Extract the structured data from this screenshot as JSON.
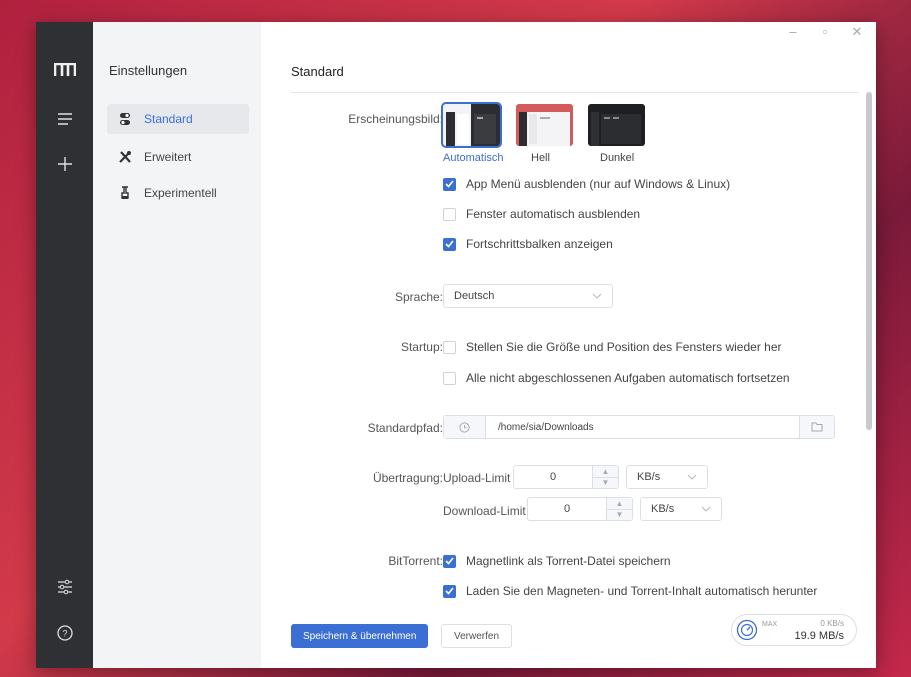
{
  "rail": {
    "logo": "m-logo",
    "icons": [
      "menu-icon",
      "plus-icon",
      "sliders-icon",
      "help-icon"
    ]
  },
  "sidebar": {
    "title": "Einstellungen",
    "items": [
      {
        "label": "Standard",
        "icon": "toggle-icon",
        "active": true
      },
      {
        "label": "Erweitert",
        "icon": "tools-icon",
        "active": false
      },
      {
        "label": "Experimentell",
        "icon": "flask-icon",
        "active": false
      }
    ]
  },
  "window_controls": [
    "minimize-icon",
    "maximize-icon",
    "close-icon"
  ],
  "main": {
    "title": "Standard",
    "appearance": {
      "label": "Erscheinungsbild:",
      "options": [
        "Automatisch",
        "Hell",
        "Dunkel"
      ],
      "selected": "Automatisch",
      "checks": [
        {
          "label": "App Menü ausblenden (nur auf Windows & Linux)",
          "checked": true
        },
        {
          "label": "Fenster automatisch ausblenden",
          "checked": false
        },
        {
          "label": "Fortschrittsbalken anzeigen",
          "checked": true
        }
      ]
    },
    "language": {
      "label": "Sprache:",
      "value": "Deutsch"
    },
    "startup": {
      "label": "Startup:",
      "checks": [
        {
          "label": "Stellen Sie die Größe und Position des Fensters wieder her",
          "checked": false
        },
        {
          "label": "Alle nicht abgeschlossenen Aufgaben automatisch fortsetzen",
          "checked": false
        }
      ]
    },
    "default_path": {
      "label": "Standardpfad:",
      "value": "/home/sia/Downloads"
    },
    "transfer": {
      "label": "Übertragung:",
      "upload": {
        "label": "Upload-Limit",
        "value": "0",
        "unit": "KB/s"
      },
      "download": {
        "label": "Download-Limit",
        "value": "0",
        "unit": "KB/s"
      }
    },
    "bittorrent": {
      "label": "BitTorrent:",
      "checks": [
        {
          "label": "Magnetlink als Torrent-Datei speichern",
          "checked": true
        },
        {
          "label": "Laden Sie den Magneten- und Torrent-Inhalt automatisch herunter",
          "checked": true
        }
      ]
    },
    "buttons": {
      "save": "Speichern & übernehmen",
      "discard": "Verwerfen"
    },
    "speedometer": {
      "max_label": "MAX",
      "upload": "0 KB/s",
      "download": "19.9 MB/s"
    }
  },
  "colors": {
    "accent": "#3b6fd4",
    "rail": "#2e3033",
    "sidebar": "#f3f4f6"
  }
}
